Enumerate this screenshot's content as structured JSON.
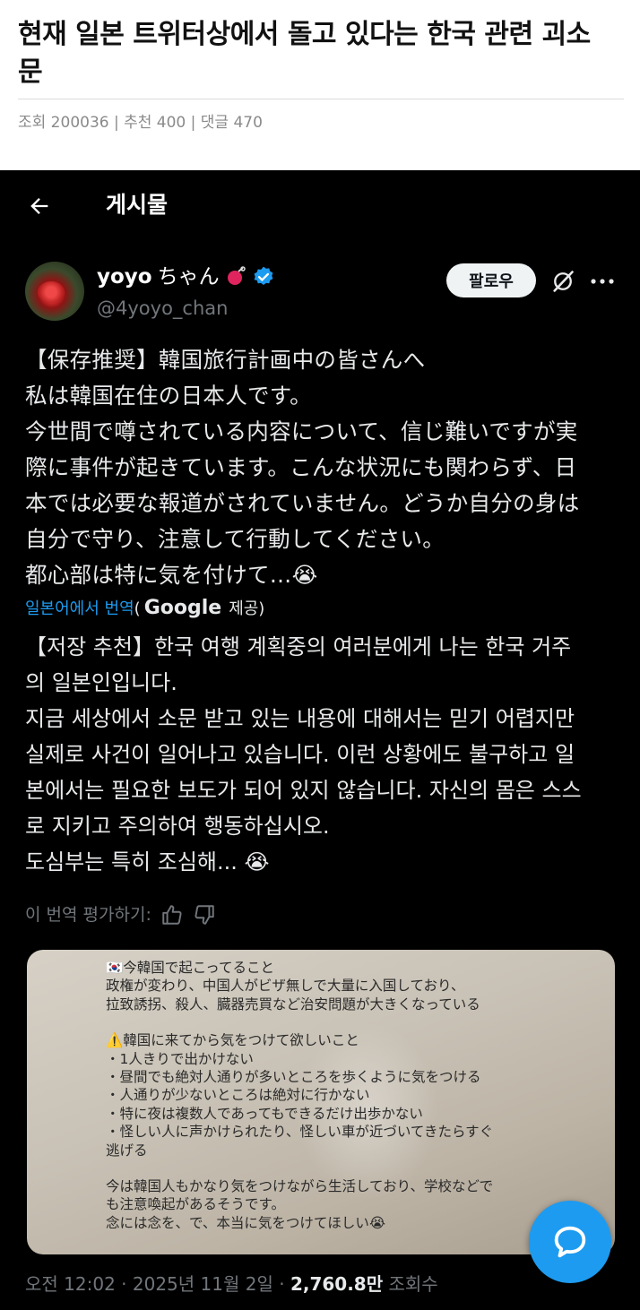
{
  "article": {
    "title": "현재 일본 트위터상에서 돌고 있다는 한국 관련 괴소문",
    "meta": "조회 200036 | 추천 400 | 댓글 470"
  },
  "twitter": {
    "header_title": "게시물",
    "user": {
      "name": "yoyo",
      "name_kana": "ちゃん",
      "handle": "@4yoyo_chan"
    },
    "follow_label": "팔로우",
    "tweet_lines": [
      "【保存推奨】韓国旅行計画中の皆さんへ",
      "私は韓国在住の日本人です。",
      "今世間で噂されている内容について、信じ難いですが実",
      "際に事件が起きています。こんな状況にも関わらず、日",
      "本では必要な報道がされていません。どうか自分の身は",
      "自分で守り、注意して行動してください。",
      "都心部は特に気を付けて…😭"
    ],
    "translate": {
      "link": "일본어에서 번역",
      "open": "(",
      "google": "Google",
      "provider": "제공)"
    },
    "translated_lines": [
      "【저장 추천】한국 여행 계획중의 여러분에게 나는 한국 거주",
      "의 일본인입니다.",
      "지금 세상에서 소문 받고 있는 내용에 대해서는 믿기 어렵지만",
      "실제로 사건이 일어나고 있습니다. 이런 상황에도 불구하고 일",
      "본에서는 필요한 보도가 되어 있지 않습니다. 자신의 몸은 스스",
      "로 지키고 주의하여 행동하십시오.",
      "도심부는 특히 조심해... 😭"
    ],
    "rate_label": "이 번역 평가하기:",
    "photo_lines": [
      "🇰🇷今韓国で起こってること",
      "政権が変わり、中国人がビザ無しで大量に入国しており、",
      "拉致誘拐、殺人、臓器売買など治安問題が大きくなっている",
      "",
      "⚠️韓国に来てから気をつけて欲しいこと",
      "・1人きりで出かけない",
      "・昼間でも絶対人通りが多いところを歩くように気をつける",
      "・人通りが少ないところは絶対に行かない",
      "・特に夜は複数人であってもできるだけ出歩かない",
      "・怪しい人に声かけられたり、怪しい車が近づいてきたらすぐ",
      "逃げる",
      "",
      "今は韓国人もかなり気をつけながら生活しており、学校などで",
      "も注意喚起があるそうです。",
      "念には念を、で、本当に気をつけてほしい😭"
    ],
    "meta": {
      "time": "오전 12:02 · 2025년 11월 2일 · ",
      "views": "2,760.8만",
      "views_label": " 조회수"
    }
  },
  "colors": {
    "accent": "#1d9bf0",
    "background": "#000000",
    "text": "#e7e9ea",
    "muted": "#71767b"
  }
}
